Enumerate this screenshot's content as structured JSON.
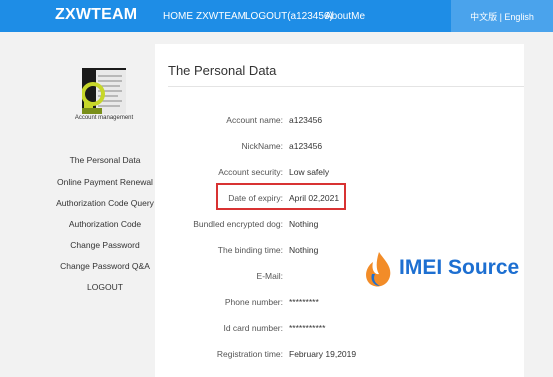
{
  "header": {
    "logo": "ZXWTEAM",
    "nav": [
      "HOME",
      "ZXWTEAM",
      "LOGOUT(a123456)",
      "AboutMe"
    ],
    "language": "中文版 | English"
  },
  "sidebar": {
    "avatar_caption": "Account management",
    "items": [
      "The Personal Data",
      "Online Payment Renewal",
      "Authorization Code Query",
      "Authorization Code",
      "Change Password",
      "Change Password Q&A",
      "LOGOUT"
    ]
  },
  "panel": {
    "title": "The Personal Data",
    "fields": [
      {
        "label": "Account name:",
        "value": "a123456"
      },
      {
        "label": "NickName:",
        "value": "a123456"
      },
      {
        "label": "Account security:",
        "value": "Low safely"
      },
      {
        "label": "Date of expiry:",
        "value": "April 02,2021"
      },
      {
        "label": "Bundled encrypted dog:",
        "value": "Nothing"
      },
      {
        "label": "The binding time:",
        "value": "Nothing"
      },
      {
        "label": "E-Mail:",
        "value": ""
      },
      {
        "label": "Phone number:",
        "value": "*********"
      },
      {
        "label": "Id card number:",
        "value": "***********"
      },
      {
        "label": "Registration time:",
        "value": "February 19,2019"
      }
    ]
  },
  "watermark": {
    "text": "IMEI Source"
  },
  "colors": {
    "header_bg": "#1e8de6",
    "language_bg": "#4aa3ec",
    "highlight_border": "#d83232",
    "watermark": "#1d6fd1"
  }
}
